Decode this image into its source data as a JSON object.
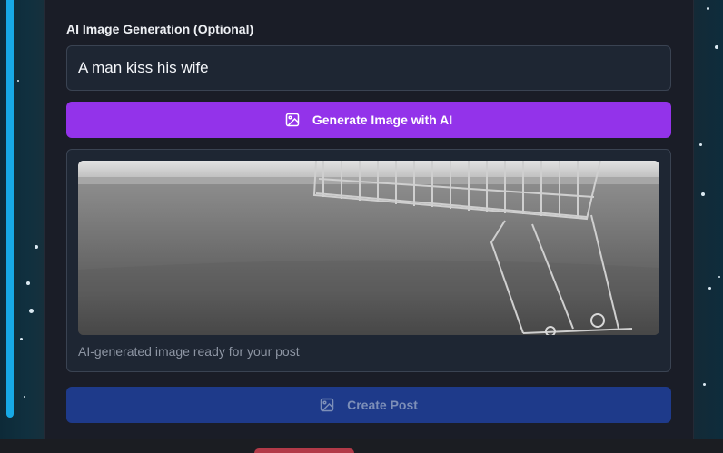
{
  "ai_section": {
    "label": "AI Image Generation (Optional)",
    "prompt_value": "A man kiss his wife"
  },
  "generate_button": {
    "label": "Generate Image with AI",
    "icon": "image-icon"
  },
  "preview": {
    "caption": "AI-generated image ready for your post",
    "image_subject": "shopping-cart-photo"
  },
  "create_button": {
    "label": "Create Post",
    "icon": "image-icon",
    "state": "disabled"
  },
  "colors": {
    "accent_purple": "#9333ea",
    "create_blue": "#1e3a8a",
    "sidebar_accent": "#17a9e6",
    "panel_bg": "#1a1d27"
  }
}
